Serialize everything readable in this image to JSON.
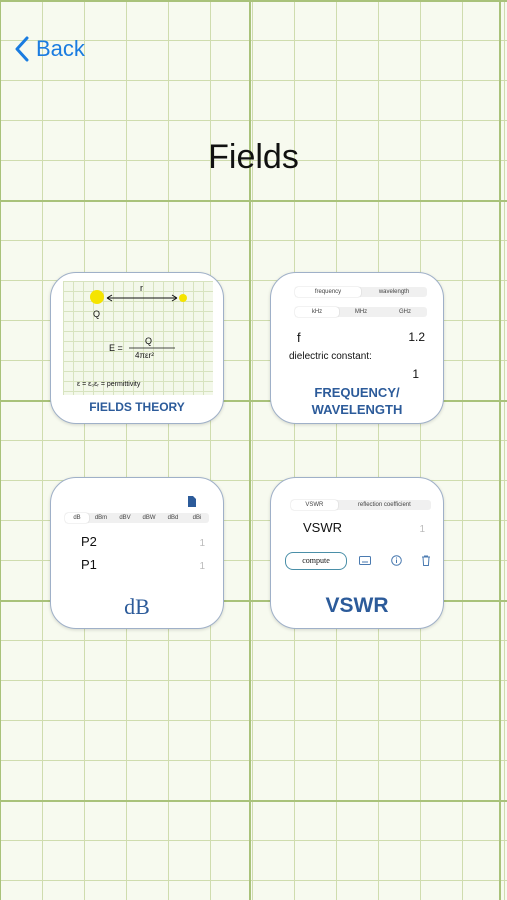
{
  "nav": {
    "back_label": "Back"
  },
  "page": {
    "title": "Fields"
  },
  "tiles": {
    "fields_theory": {
      "label": "FIELDS THEORY",
      "r": "r",
      "q": "Q",
      "e_eq": "E =",
      "numerator": "Q",
      "denominator": "4πεr²",
      "permittivity": "ε = ε₀εᵣ = permittivity"
    },
    "frequency": {
      "label_line1": "FREQUENCY/",
      "label_line2": "WAVELENGTH",
      "mode_tabs": [
        "frequency",
        "wavelength"
      ],
      "unit_tabs": [
        "kHz",
        "MHz",
        "GHz"
      ],
      "f_label": "f",
      "f_value": "1.2",
      "dielectric_label": "dielectric constant:",
      "dielectric_value": "1"
    },
    "db": {
      "label": "dB",
      "unit_tabs": [
        "dB",
        "dBm",
        "dBV",
        "dBW",
        "dBd",
        "dBi"
      ],
      "p2_label": "P2",
      "p2_value": "1",
      "p1_label": "P1",
      "p1_value": "1"
    },
    "vswr": {
      "label": "VSWR",
      "mode_tabs": [
        "VSWR",
        "reflection coefficient"
      ],
      "vswr_label": "VSWR",
      "vswr_value": "1",
      "compute_label": "compute"
    }
  }
}
